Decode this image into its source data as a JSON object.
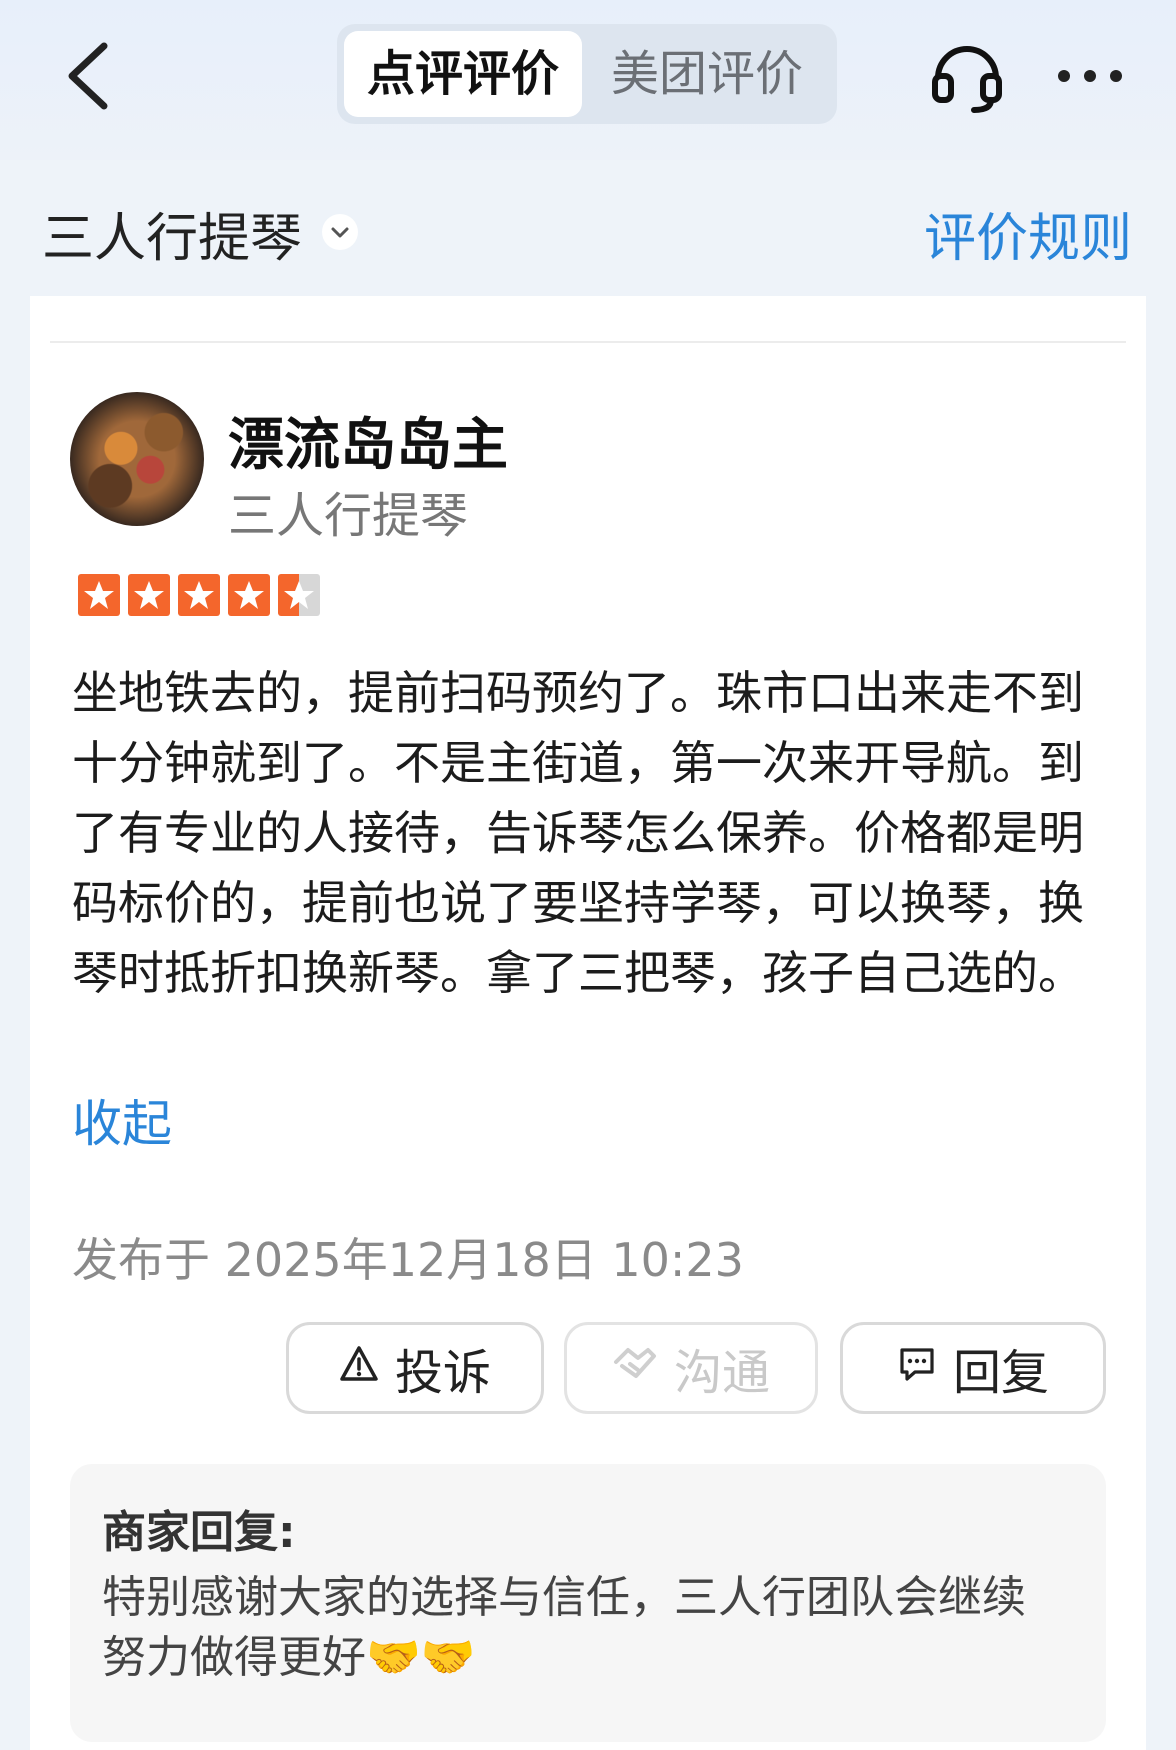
{
  "header": {
    "tabs": [
      {
        "label": "点评评价",
        "active": true
      },
      {
        "label": "美团评价",
        "active": false
      }
    ]
  },
  "shop": {
    "name": "三人行提琴",
    "rules_link": "评价规则"
  },
  "review": {
    "user_name": "漂流岛岛主",
    "shop_name": "三人行提琴",
    "rating": 4.5,
    "text": "坐地铁去的，提前扫码预约了。珠市口出来走不到十分钟就到了。不是主街道，第一次来开导航。到了有专业的人接待，告诉琴怎么保养。价格都是明码标价的，提前也说了要坚持学琴，可以换琴，换琴时抵折扣换新琴。拿了三把琴，孩子自己选的。",
    "collapse_label": "收起",
    "published": "发布于 2025年12月18日 10:23"
  },
  "actions": {
    "complain_label": "投诉",
    "chat_label": "沟通",
    "reply_label": "回复"
  },
  "merchant_reply": {
    "label": "商家回复:",
    "text": "特别感谢大家的选择与信任，三人行团队会继续努力做得更好🤝🤝"
  },
  "colors": {
    "accent": "#2a85d9",
    "star": "#f4662c"
  }
}
